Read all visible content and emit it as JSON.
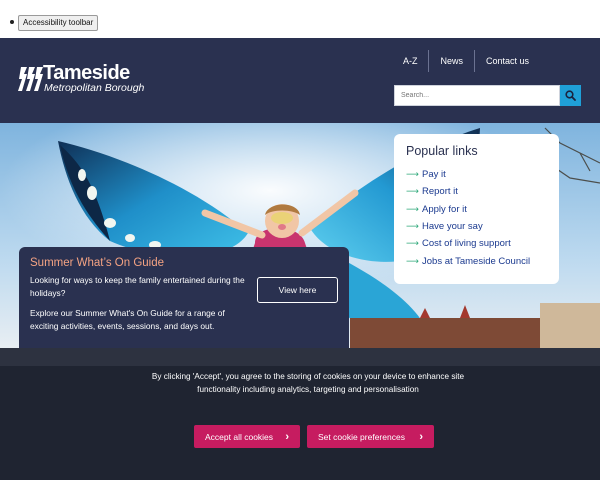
{
  "utility": {
    "accessibility_label": "Accessibility toolbar"
  },
  "header": {
    "logo_name": "Tameside",
    "logo_sub": "Metropolitan Borough",
    "nav": [
      "A-Z",
      "News",
      "Contact us"
    ],
    "search_placeholder": "Search..."
  },
  "popular": {
    "title": "Popular links",
    "links": [
      "Pay it",
      "Report it",
      "Apply for it",
      "Have your say",
      "Cost of living support",
      "Jobs at Tameside Council"
    ]
  },
  "summer": {
    "title": "Summer What’s On Guide",
    "text1": "Looking for ways to keep the family entertained during the holidays?",
    "text2": "Explore our Summer What's On Guide for a range of exciting activities, events, sessions, and days out.",
    "button": "View here"
  },
  "cookie": {
    "message": "By clicking 'Accept', you agree to the storing of cookies on your device to enhance site functionality including analytics, targeting and personalisation",
    "accept_label": "Accept all cookies",
    "prefs_label": "Set cookie preferences"
  },
  "colors": {
    "header_bg": "#2a3150",
    "search_button": "#1fa0d8",
    "cookie_button": "#c61c60",
    "link": "#1b3a8f",
    "summer_title": "#f4a383"
  }
}
